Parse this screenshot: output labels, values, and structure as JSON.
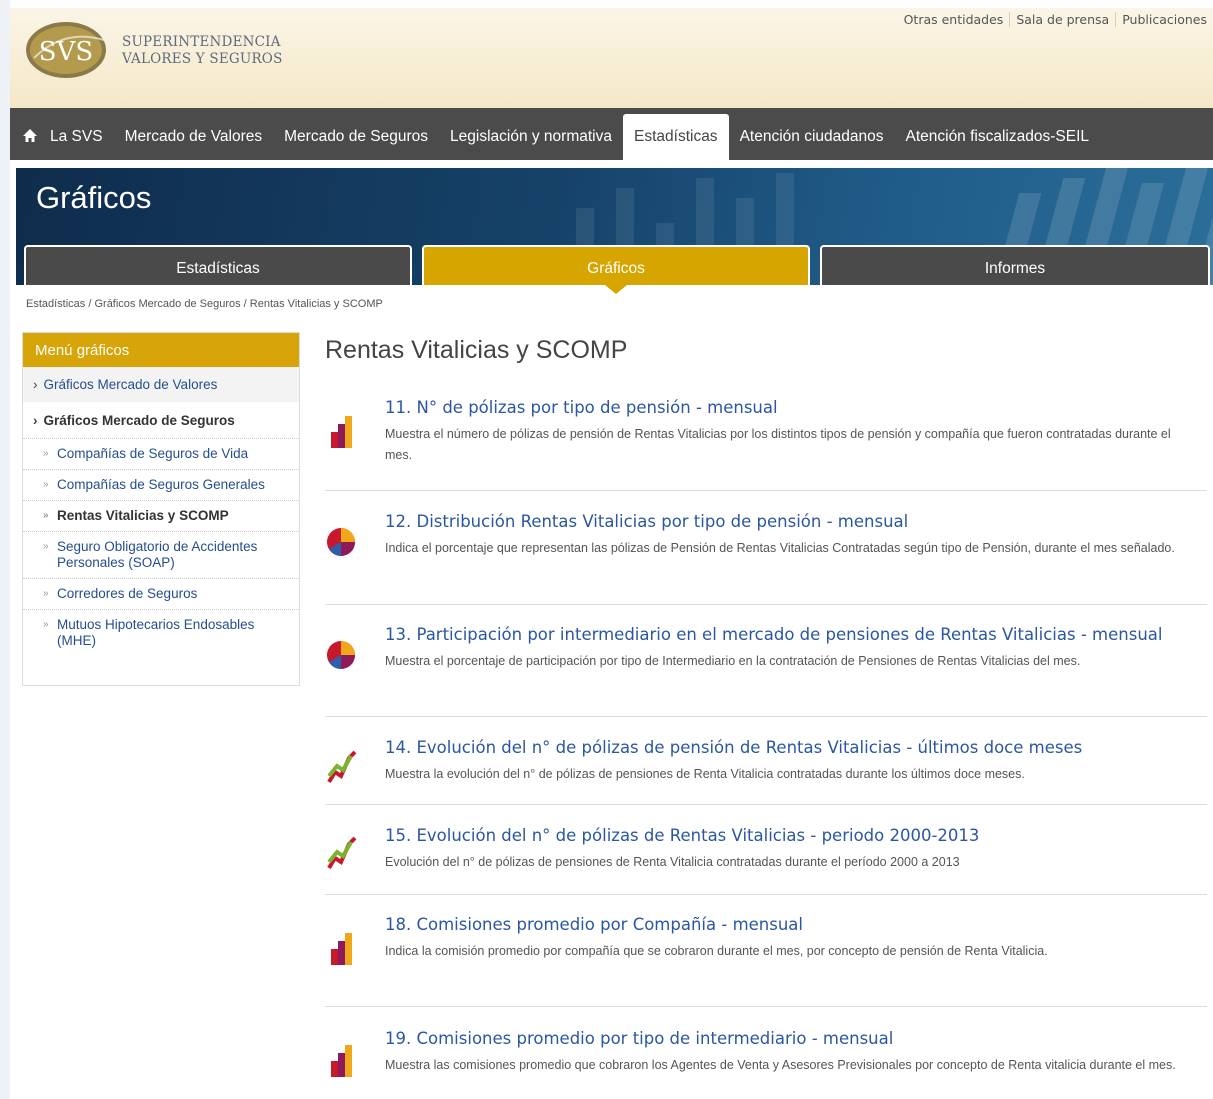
{
  "header": {
    "logo_text": "SVS",
    "org_line1": "SUPERINTENDENCIA",
    "org_line2": "VALORES Y SEGUROS",
    "top_links": [
      "Otras entidades",
      "Sala de prensa",
      "Publicaciones"
    ]
  },
  "nav": {
    "items": [
      "La SVS",
      "Mercado de Valores",
      "Mercado de Seguros",
      "Legislación y normativa",
      "Estadísticas",
      "Atención ciudadanos",
      "Atención fiscalizados-SEIL"
    ],
    "active": "Estadísticas"
  },
  "banner": {
    "title": "Gráficos",
    "tabs": [
      "Estadísticas",
      "Gráficos",
      "Informes"
    ],
    "active_tab": "Gráficos"
  },
  "breadcrumb": "Estadísticas  /  Gráficos Mercado de Seguros  /  Rentas Vitalicias y SCOMP",
  "sidebar": {
    "title": "Menú gráficos",
    "section1": "Gráficos Mercado de Valores",
    "section2": "Gráficos Mercado de Seguros",
    "subitems": [
      "Compañías de Seguros de Vida",
      "Compañías de Seguros Generales",
      "Rentas Vitalicias y SCOMP",
      "Seguro Obligatorio de Accidentes Personales (SOAP)",
      "Corredores de Seguros",
      "Mutuos Hipotecarios Endosables (MHE)"
    ]
  },
  "main": {
    "title": "Rentas Vitalicias y SCOMP",
    "items": [
      {
        "icon": "bar-chart-icon",
        "title": "11. N° de pólizas por tipo de pensión - mensual",
        "desc": "Muestra el número de pólizas de pensión de Rentas Vitalicias por los distintos tipos de pensión y compañía que fueron contratadas durante el mes."
      },
      {
        "icon": "pie-chart-icon",
        "title": "12. Distribución Rentas Vitalicias por tipo de pensión - mensual",
        "desc": "Indica el porcentaje que representan las pólizas de Pensión de Rentas Vitalicias Contratadas según tipo de Pensión, durante el mes señalado."
      },
      {
        "icon": "pie-chart-icon",
        "title": "13. Participación por intermediario en el mercado de pensiones de Rentas Vitalicias - mensual",
        "desc": "Muestra el porcentaje de participación por tipo de Intermediario en la contratación de Pensiones de Rentas Vitalicias del mes."
      },
      {
        "icon": "line-chart-icon",
        "title": "14. Evolución del n° de pólizas de pensión de Rentas Vitalicias - últimos doce meses",
        "desc": "Muestra la evolución del n° de pólizas de pensiones de Renta Vitalicia contratadas durante los últimos doce meses."
      },
      {
        "icon": "line-chart-icon",
        "title": "15. Evolución del n° de pólizas de Rentas Vitalicias - periodo 2000-2013",
        "desc": "Evolución del n° de pólizas de pensiones de Renta Vitalicia contratadas durante el período 2000 a 2013"
      },
      {
        "icon": "bar-chart-icon",
        "title": "18. Comisiones promedio por Compañía - mensual",
        "desc": "Indica la comisión promedio por compañía que se cobraron durante el mes, por concepto de pensión de Renta Vitalicia."
      },
      {
        "icon": "bar-chart-icon",
        "title": "19. Comisiones promedio por tipo de intermediario - mensual",
        "desc": "Muestra las comisiones promedio que cobraron los Agentes de Venta y Asesores Previsionales por concepto de Renta vitalicia durante el mes."
      }
    ]
  }
}
